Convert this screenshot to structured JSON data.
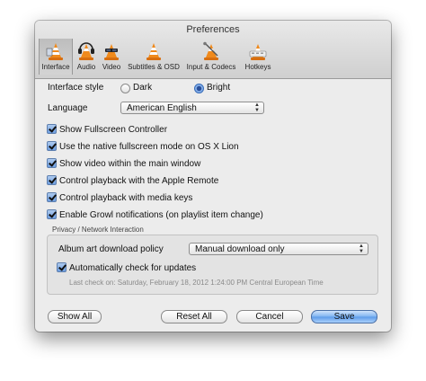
{
  "window": {
    "title": "Preferences"
  },
  "toolbar": {
    "items": [
      {
        "label": "Interface",
        "icon": "interface-icon",
        "active": true
      },
      {
        "label": "Audio",
        "icon": "audio-icon"
      },
      {
        "label": "Video",
        "icon": "video-icon"
      },
      {
        "label": "Subtitles & OSD",
        "icon": "subtitles-icon"
      },
      {
        "label": "Input & Codecs",
        "icon": "input-codecs-icon"
      },
      {
        "label": "Hotkeys",
        "icon": "hotkeys-icon"
      }
    ]
  },
  "interface_style": {
    "label": "Interface style",
    "options": [
      {
        "label": "Dark",
        "selected": false
      },
      {
        "label": "Bright",
        "selected": true
      }
    ]
  },
  "language": {
    "label": "Language",
    "value": "American English"
  },
  "checkboxes": [
    {
      "label": "Show Fullscreen Controller",
      "checked": true
    },
    {
      "label": "Use the native fullscreen mode on OS X Lion",
      "checked": true
    },
    {
      "label": "Show video within the main window",
      "checked": true
    },
    {
      "label": "Control playback with the Apple Remote",
      "checked": true
    },
    {
      "label": "Control playback with media keys",
      "checked": true
    },
    {
      "label": "Enable Growl notifications (on playlist item change)",
      "checked": true
    }
  ],
  "privacy": {
    "title": "Privacy / Network Interaction",
    "album_art_label": "Album art download policy",
    "album_art_value": "Manual download only",
    "auto_update_label": "Automatically check for updates",
    "last_check": "Last check on: Saturday, February 18, 2012 1:24:00 PM Central European Time"
  },
  "buttons": {
    "show_all": "Show All",
    "reset_all": "Reset All",
    "cancel": "Cancel",
    "save": "Save"
  },
  "colors": {
    "accent": "#5c9ae9",
    "cone_orange": "#f08a1c"
  }
}
